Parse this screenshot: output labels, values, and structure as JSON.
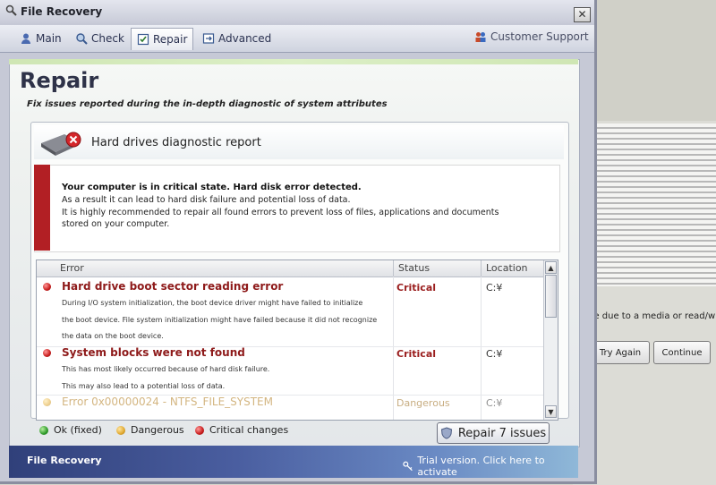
{
  "window": {
    "title": "File Recovery"
  },
  "tabs": [
    {
      "label": "Main",
      "icon": "user-icon"
    },
    {
      "label": "Check",
      "icon": "magnifier-icon"
    },
    {
      "label": "Repair",
      "icon": "checklist-icon"
    },
    {
      "label": "Advanced",
      "icon": "settings-icon"
    }
  ],
  "support": {
    "label": "Customer Support",
    "icon": "people-icon"
  },
  "page": {
    "title": "Repair",
    "subtitle": "Fix issues reported during the in-depth diagnostic of system attributes"
  },
  "report": {
    "title": "Hard drives diagnostic report",
    "icon": "hard-drive-error-icon"
  },
  "alert": {
    "headline": "Your computer is in critical state. Hard disk error detected.",
    "line1": "As a result it can lead to hard disk failure and potential loss of data.",
    "line2": "It is highly recommended to repair all found errors to prevent loss of files, applications and documents",
    "line3": "stored on your computer."
  },
  "table": {
    "columns": [
      "Error",
      "Status",
      "Location"
    ],
    "rows": [
      {
        "title": "Hard drive boot sector reading error",
        "desc": [
          "During I/O system initialization, the boot device driver might have failed to initialize",
          "the boot device. File system initialization might have failed because it did not recognize",
          "the data on the boot device."
        ],
        "status": "Critical",
        "location": "C:¥",
        "severity": "critical"
      },
      {
        "title": "System blocks were not found",
        "desc": [
          "This has most likely occurred because of hard disk failure.",
          "This may also lead to a potential loss of data."
        ],
        "status": "Critical",
        "location": "C:¥",
        "severity": "critical"
      },
      {
        "title": "Error 0x00000024 - NTFS_FILE_SYSTEM",
        "desc": [],
        "status": "Dangerous",
        "location": "C:¥",
        "severity": "dangerous"
      }
    ]
  },
  "legend": {
    "ok": "Ok (fixed)",
    "dangerous": "Dangerous",
    "critical": "Critical changes"
  },
  "repair_button": {
    "label": "Repair 7 issues",
    "icon": "shield-icon"
  },
  "footer": {
    "left": "File Recovery",
    "right": "Trial version. Click here to activate",
    "icon": "key-icon"
  },
  "background_dialog": {
    "message": "y be due to a media or read/write e",
    "try_again": "Try Again",
    "continue": "Continue"
  },
  "colors": {
    "critical": "#9a1e1e",
    "alert_bar": "#b21f24",
    "footer_start": "#30407a",
    "footer_end": "#8fb8d8"
  }
}
